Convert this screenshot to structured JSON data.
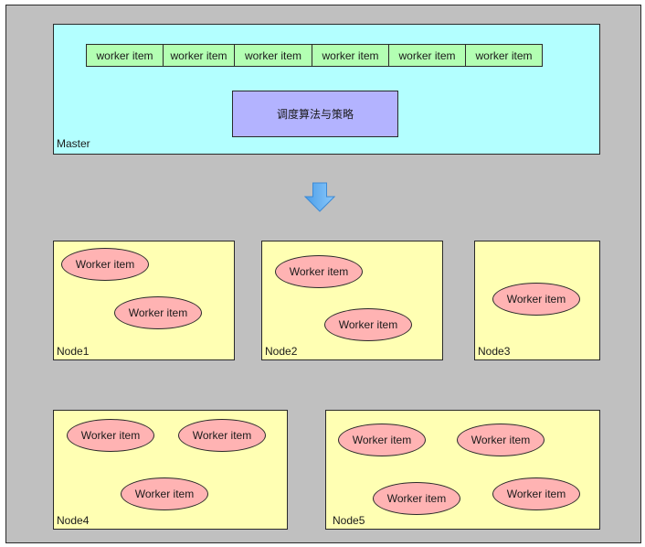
{
  "master": {
    "label": "Master",
    "queue_items": [
      "worker item",
      "worker item",
      "worker item",
      "worker item",
      "worker item",
      "worker item"
    ],
    "scheduler_label": "调度算法与策略"
  },
  "arrow": {
    "icon": "down-arrow-icon",
    "direction": "down"
  },
  "nodes": [
    {
      "label": "Node1",
      "items": [
        "Worker item",
        "Worker item"
      ]
    },
    {
      "label": "Node2",
      "items": [
        "Worker item",
        "Worker item"
      ]
    },
    {
      "label": "Node3",
      "items": [
        "Worker item"
      ]
    },
    {
      "label": "Node4",
      "items": [
        "Worker item",
        "Worker item",
        "Worker item"
      ]
    },
    {
      "label": "Node5",
      "items": [
        "Worker item",
        "Worker item",
        "Worker item",
        "Worker item"
      ]
    }
  ],
  "colors": {
    "background": "#c0c0c0",
    "master": "#b3ffff",
    "queue_item": "#b3ffb3",
    "scheduler": "#b3b3ff",
    "node": "#ffffb3",
    "worker": "#ffb3b3",
    "arrow": "#5aaef0"
  }
}
